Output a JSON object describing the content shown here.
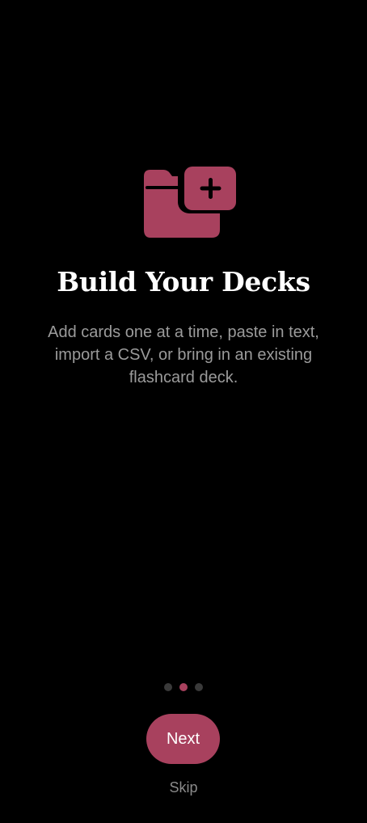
{
  "onboarding": {
    "icon": "folder-plus-icon",
    "title": "Build Your Decks",
    "description": "Add cards one at a time, paste in text, import a CSV, or bring in an existing flashcard deck.",
    "pagination": {
      "total_pages": 3,
      "current_page": 2
    },
    "next_label": "Next",
    "skip_label": "Skip"
  },
  "colors": {
    "accent": "#a8415e",
    "background": "#000000",
    "title": "#ffffff",
    "description": "#9b9b9b",
    "inactive_dot": "#3a3a3a",
    "skip": "#8a8a8a"
  }
}
